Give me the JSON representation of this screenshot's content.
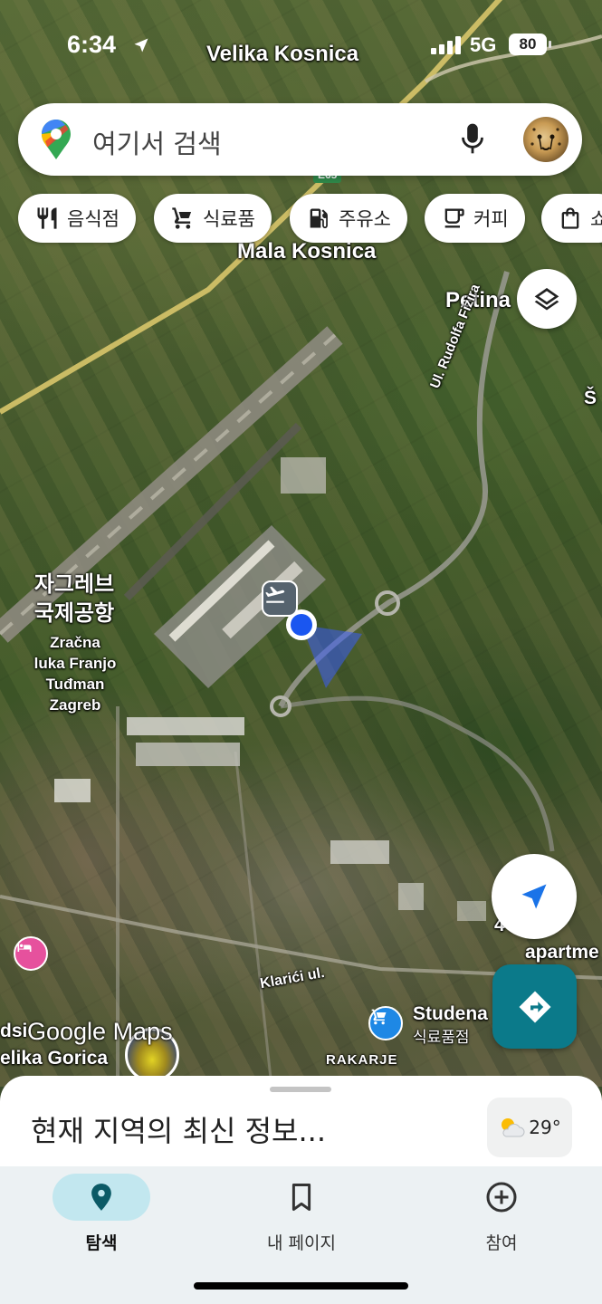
{
  "status_bar": {
    "time": "6:34",
    "network": "5G",
    "battery": "80"
  },
  "search": {
    "placeholder": "여기서 검색"
  },
  "chips": [
    {
      "label": "음식점",
      "icon": "fork-knife-icon"
    },
    {
      "label": "식료품",
      "icon": "cart-icon"
    },
    {
      "label": "주유소",
      "icon": "gas-station-icon"
    },
    {
      "label": "커피",
      "icon": "coffee-cup-icon"
    },
    {
      "label": "쇼",
      "icon": "shopping-bag-icon"
    }
  ],
  "map_labels": {
    "velika_kosnica": "Velika Kosnica",
    "mala_kosnica": "Mala Kosnica",
    "petina": "Petina",
    "ul_rudolfa_fizira": "Ul. Rudolfa Fizira",
    "airport_ko_1": "자그레브",
    "airport_ko_2": "국제공항",
    "airport_hr_1": "Zračna",
    "airport_hr_2": "luka Franjo",
    "airport_hr_3": "Tuđman",
    "airport_hr_4": "Zagreb",
    "klarici": "Klarići ul.",
    "studena": "Studena",
    "studena_sub": "식료품점",
    "rakarje": "RAKARJE",
    "velika_gorica": "elika Gorica",
    "dsi": "dsi",
    "airp": "4 Airp",
    "apartme": "apartme",
    "sc": "Š",
    "e65": "E65"
  },
  "map_logo": "Google Maps",
  "bottom_sheet": {
    "title": "현재 지역의 최신 정보...",
    "temperature": "29°",
    "weather_icon": "partly-cloudy-icon"
  },
  "nav": [
    {
      "label": "탐색",
      "icon": "location-pin-icon",
      "active": true
    },
    {
      "label": "내 페이지",
      "icon": "bookmark-icon",
      "active": false
    },
    {
      "label": "참여",
      "icon": "add-circle-icon",
      "active": false
    }
  ],
  "colors": {
    "accent_teal": "#0b7a8a",
    "active_nav_pill": "#c2e7ef",
    "location_dot": "#1a56f0"
  }
}
